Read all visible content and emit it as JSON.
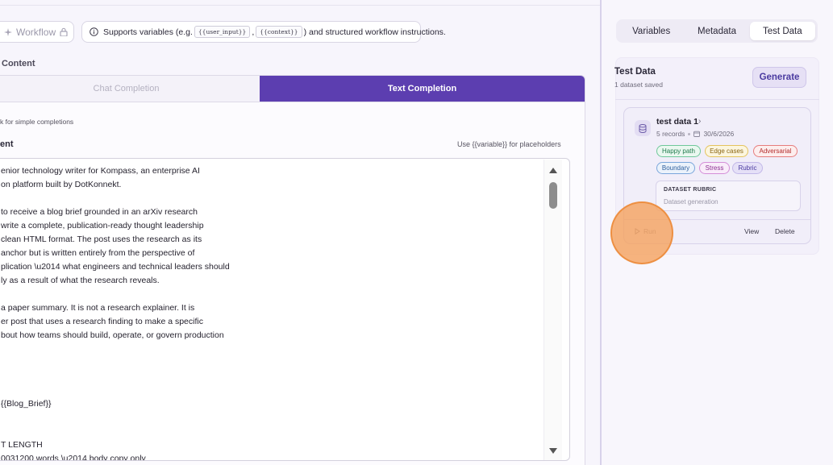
{
  "toolbar": {
    "workflow_label": "Workflow",
    "hint_prefix": "Supports variables (e.g.",
    "hint_var1": "{{user_input}}",
    "hint_comma": ",",
    "hint_var2": "{{context}}",
    "hint_suffix": ") and structured workflow instructions."
  },
  "section_label": "Content",
  "mode_tabs": [
    {
      "label": "Chat Completion",
      "active": false
    },
    {
      "label": "Text Completion",
      "active": true
    }
  ],
  "editor": {
    "mode_description": "k for simple completions",
    "content_label": "ent",
    "placeholder_hint": "Use {{variable}} for placeholders",
    "lines": [
      "enior technology writer for Kompass, an enterprise AI",
      "on platform built by DotKonnekt.",
      "",
      "to receive a blog brief grounded in an arXiv research",
      "write a complete, publication-ready thought leadership",
      "clean HTML format. The post uses the research as its",
      "anchor but is written entirely from the perspective of",
      "plication \\u2014 what engineers and technical leaders should",
      "ly as a result of what the research reveals.",
      "",
      "a paper summary. It is not a research explainer. It is",
      "er post that uses a research finding to make a specific",
      "bout how teams should build, operate, or govern production",
      "",
      "",
      "",
      "",
      "{{Blog_Brief}}",
      "",
      "",
      "T LENGTH",
      "0031200 words \\u2014 body copy only"
    ]
  },
  "right_panel": {
    "tabs": [
      {
        "label": "Variables",
        "active": false
      },
      {
        "label": "Metadata",
        "active": false
      },
      {
        "label": "Test Data",
        "active": true
      }
    ],
    "test_data": {
      "title": "Test Data",
      "subtitle": "1 dataset saved",
      "generate_label": "Generate",
      "dataset": {
        "name": "test data 1",
        "chevron": "›",
        "records": "5 records",
        "date": "30/6/2026",
        "tags": [
          "Happy path",
          "Edge cases",
          "Adversarial",
          "Boundary",
          "Stress",
          "Rubric"
        ],
        "rubric_heading": "DATASET RUBRIC",
        "rubric_text": "Dataset generation",
        "run_label": "Run",
        "view_label": "View",
        "delete_label": "Delete"
      }
    }
  },
  "colors": {
    "accent": "#5c3eb0",
    "click_marker": "#f5a05a"
  }
}
